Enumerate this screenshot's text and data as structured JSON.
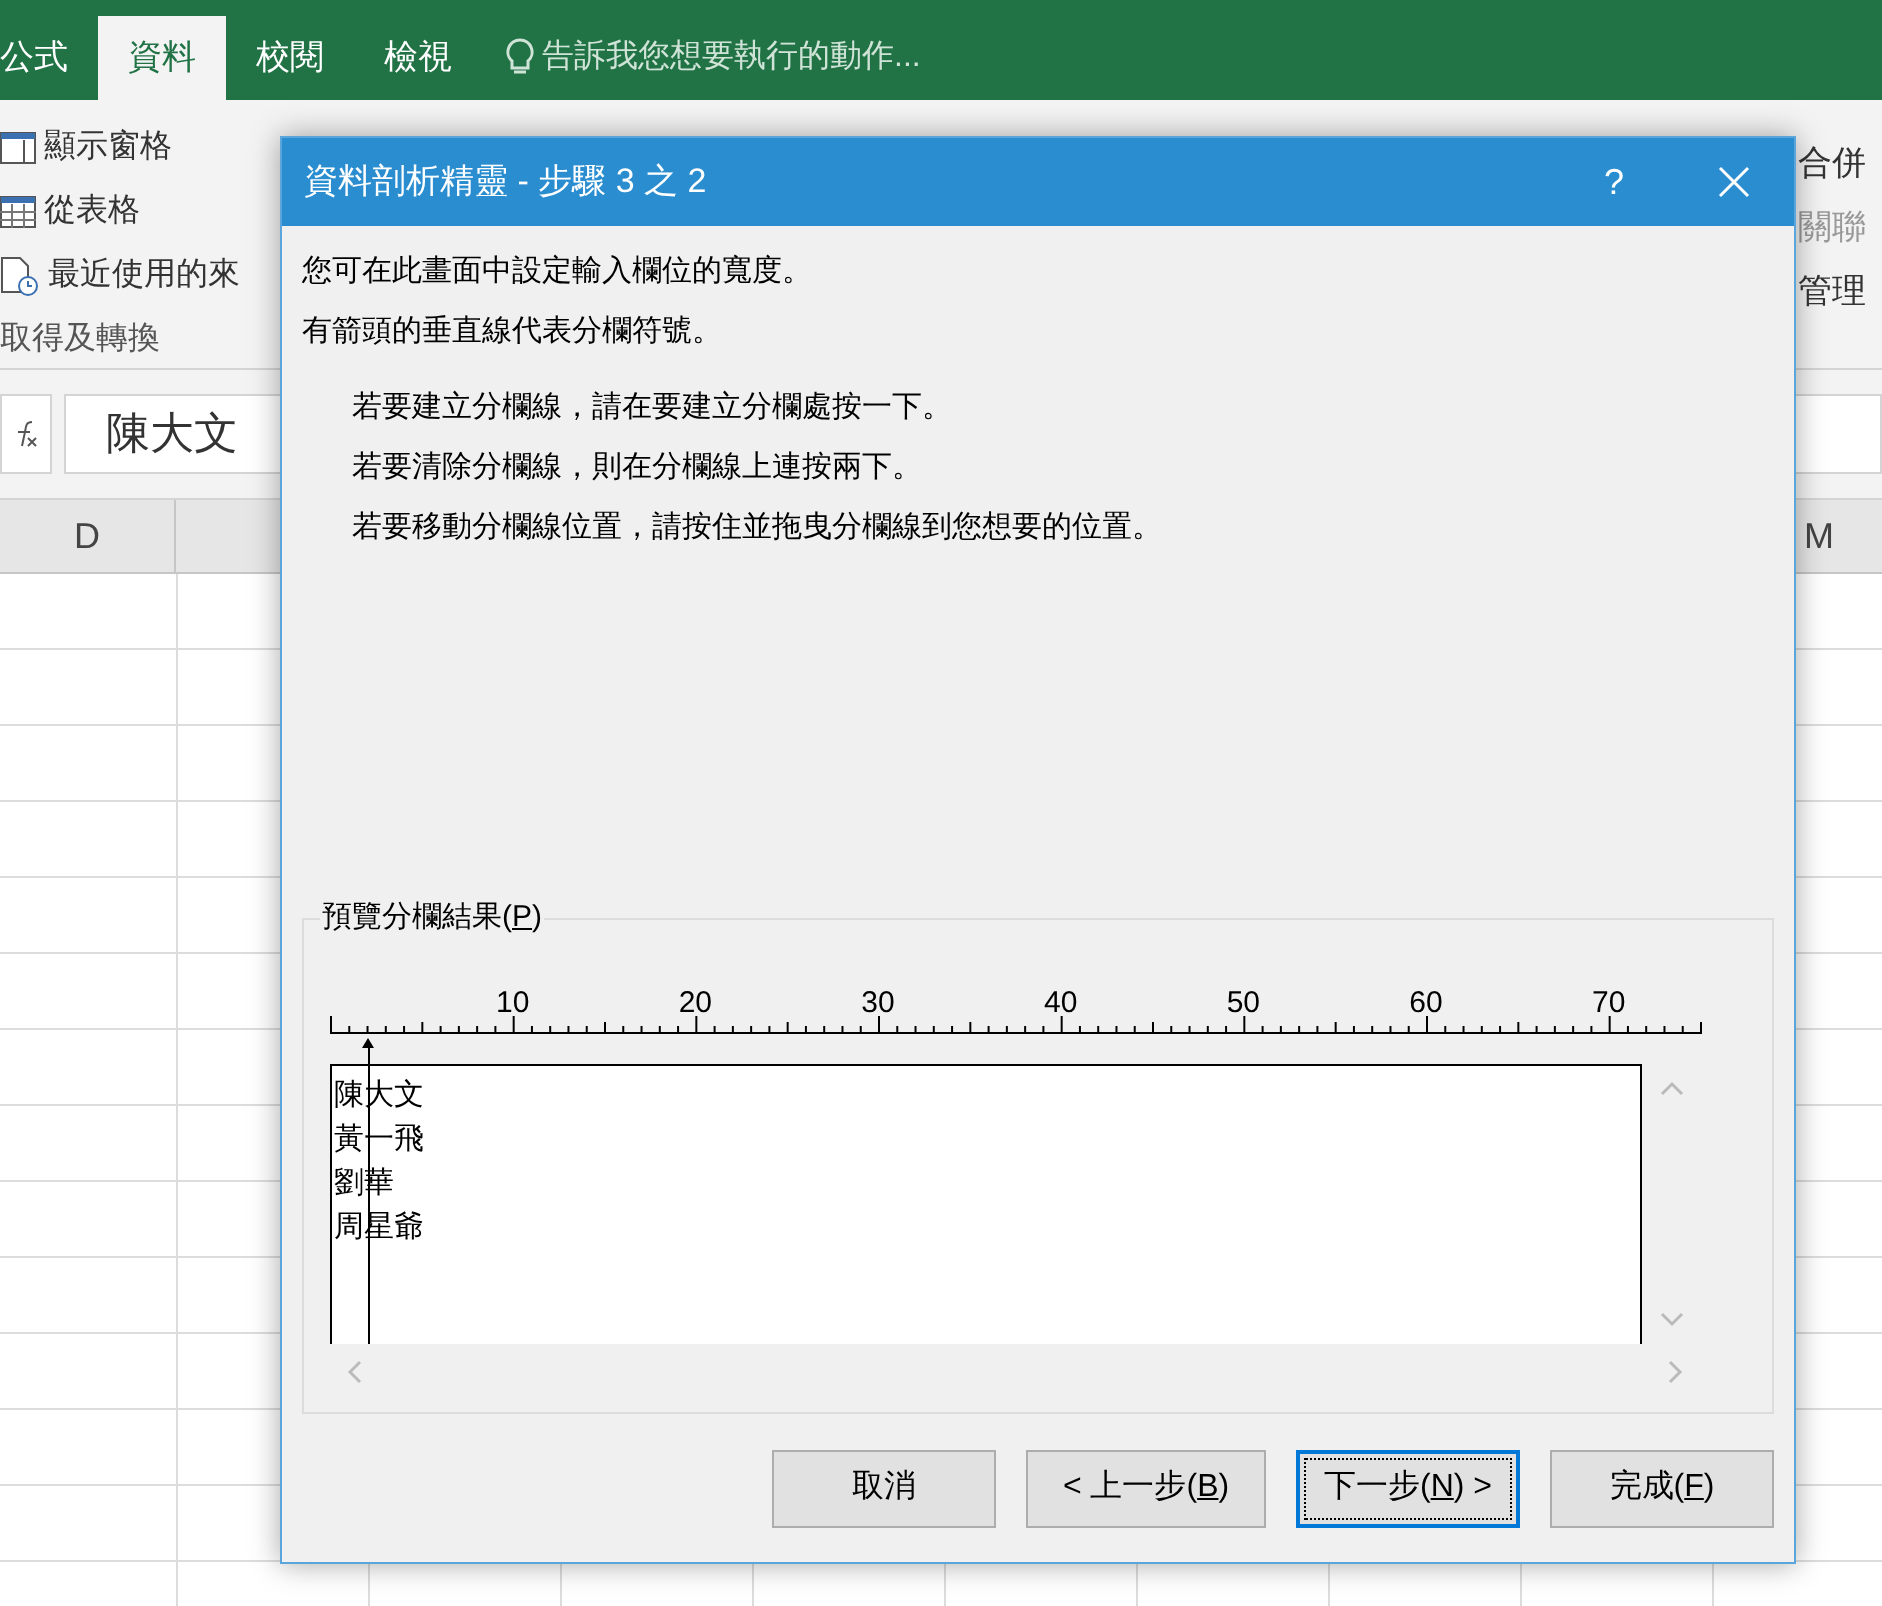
{
  "ribbon_tabs": [
    {
      "label": "公式",
      "selected": false
    },
    {
      "label": "資料",
      "selected": true
    },
    {
      "label": "校閱",
      "selected": false
    },
    {
      "label": "檢視",
      "selected": false
    }
  ],
  "tell_me": {
    "placeholder": "告訴我您想要執行的動作..."
  },
  "ribbon_left": [
    {
      "label": "顯示窗格",
      "kind": "pane"
    },
    {
      "label": "從表格",
      "kind": "table"
    },
    {
      "label": "最近使用的來",
      "kind": "recent"
    }
  ],
  "ribbon_group_label": "取得及轉換",
  "ribbon_right": [
    {
      "label": "合併",
      "disabled": false
    },
    {
      "label": "關聯",
      "disabled": true
    },
    {
      "label": "管理",
      "disabled": false
    }
  ],
  "formula_bar": {
    "value": "陳大文"
  },
  "columns": [
    {
      "label": "D"
    },
    {
      "label": "M"
    }
  ],
  "dialog": {
    "title": "資料剖析精靈 - 步驟 3 之 2",
    "help": "?",
    "intro": [
      "您可在此畫面中設定輸入欄位的寬度。",
      "有箭頭的垂直線代表分欄符號。"
    ],
    "steps": [
      "若要建立分欄線，請在要建立分欄處按一下。",
      "若要清除分欄線，則在分欄線上連按兩下。",
      "若要移動分欄線位置，請按住並拖曳分欄線到您想要的位置。"
    ],
    "preview": {
      "label": "預覽分欄結果(",
      "label_key": "P",
      "label_end": ")",
      "ruler": [
        "10",
        "20",
        "30",
        "40",
        "50",
        "60",
        "70"
      ],
      "column_break": {
        "level": 0.027
      },
      "lines": [
        "陳大文",
        "黃一飛",
        "劉華",
        "周星爺"
      ]
    },
    "buttons": [
      {
        "label": "取消",
        "default": false
      },
      {
        "label": "< 上一步(",
        "key": "B",
        "end": ")",
        "default": false
      },
      {
        "label": "下一步(",
        "key": "N",
        "end": ") >",
        "default": true
      },
      {
        "label": "完成(",
        "key": "F",
        "end": ")",
        "default": false
      }
    ]
  }
}
